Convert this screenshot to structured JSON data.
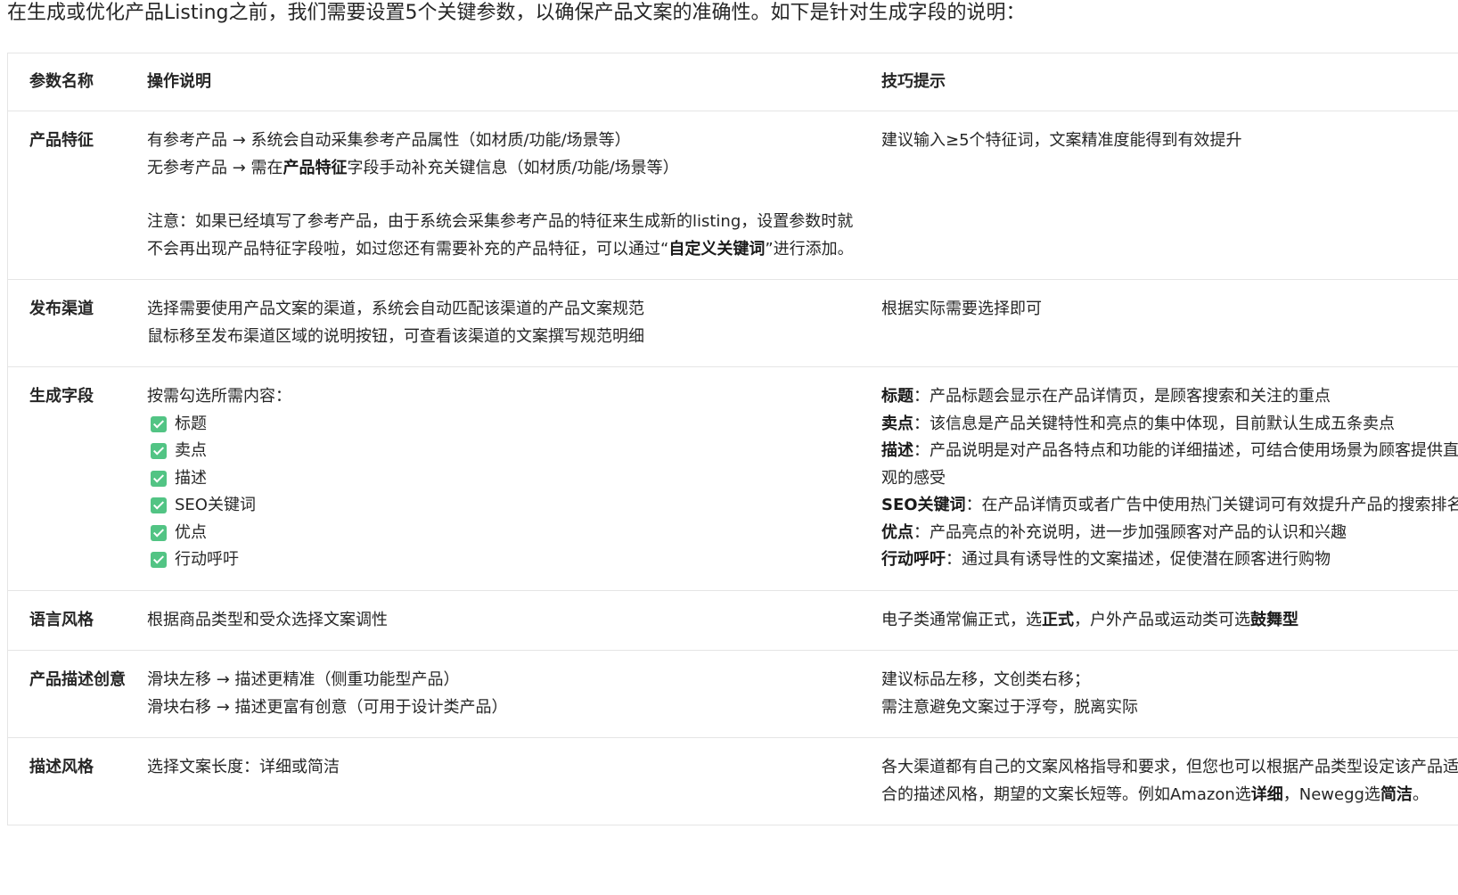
{
  "intro": "在生成或优化产品Listing之前，我们需要设置5个关键参数，以确保产品文案的准确性。如下是针对生成字段的说明：",
  "table": {
    "headers": [
      "参数名称",
      "操作说明",
      "技巧提示"
    ],
    "rows": {
      "feature": {
        "name": "产品特征",
        "desc_line1": "有参考产品 → 系统会自动采集参考产品属性（如材质/功能/场景等）",
        "desc_line2_pre": "无参考产品 → 需在",
        "desc_line2_bold": "产品特征",
        "desc_line2_post": "字段手动补充关键信息（如材质/功能/场景等）",
        "note_pre": "注意：如果已经填写了参考产品，由于系统会采集参考产品的特征来生成新的listing，设置参数时就不会再出现产品特征字段啦，如过您还有需要补充的产品特征，可以通过“",
        "note_bold": "自定义关键词",
        "note_post": "”进行添加。",
        "tip": "建议输入≥5个特征词，文案精准度能得到有效提升"
      },
      "channel": {
        "name": "发布渠道",
        "desc_line1": "选择需要使用产品文案的渠道，系统会自动匹配该渠道的产品文案规范",
        "desc_line2": "鼠标移至发布渠道区域的说明按钮，可查看该渠道的文案撰写规范明细",
        "tip": "根据实际需要选择即可"
      },
      "fields": {
        "name": "生成字段",
        "desc_intro": "按需勾选所需内容：",
        "options": [
          "标题",
          "卖点",
          "描述",
          "SEO关键词",
          "优点",
          "行动呼吁"
        ],
        "tips": [
          {
            "label": "标题",
            "text": "：产品标题会显示在产品详情页，是顾客搜索和关注的重点"
          },
          {
            "label": "卖点",
            "text": "：该信息是产品关键特性和亮点的集中体现，目前默认生成五条卖点"
          },
          {
            "label": "描述",
            "text": "：产品说明是对产品各特点和功能的详细描述，可结合使用场景为顾客提供直观的感受"
          },
          {
            "label": "SEO关键词",
            "text": "：在产品详情页或者广告中使用热门关键词可有效提升产品的搜索排名"
          },
          {
            "label": "优点",
            "text": "：产品亮点的补充说明，进一步加强顾客对产品的认识和兴趣"
          },
          {
            "label": "行动呼吁",
            "text": "：通过具有诱导性的文案描述，促使潜在顾客进行购物"
          }
        ]
      },
      "style": {
        "name": "语言风格",
        "desc": "根据商品类型和受众选择文案调性",
        "tip_pre": "电子类通常偏正式，选",
        "tip_bold1": "正式",
        "tip_mid": "，户外产品或运动类可选",
        "tip_bold2": "鼓舞型"
      },
      "creativity": {
        "name": "产品描述创意",
        "desc_line1": "滑块左移 → 描述更精准（侧重功能型产品）",
        "desc_line2": "滑块右移 → 描述更富有创意（可用于设计类产品）",
        "tip_line1": "建议标品左移，文创类右移；",
        "tip_line2": "需注意避免文案过于浮夸，脱离实际"
      },
      "desc_style": {
        "name": "描述风格",
        "desc": "选择文案长度：详细或简洁",
        "tip_pre": "各大渠道都有自己的文案风格指导和要求，但您也可以根据产品类型设定该产品适合的描述风格，期望的文案长短等。例如Amazon选",
        "tip_bold1": "详细",
        "tip_mid": "，Newegg选",
        "tip_bold2": "简洁",
        "tip_post": "。"
      }
    }
  }
}
